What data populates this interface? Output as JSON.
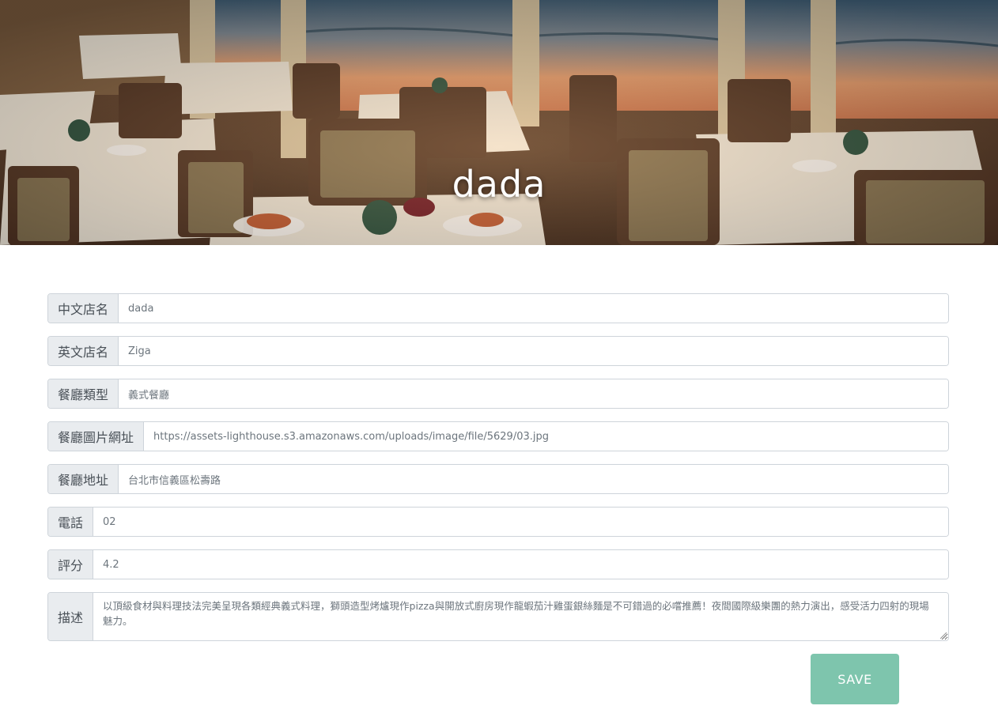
{
  "banner": {
    "title": "dada",
    "image": "restaurant-interior-photo"
  },
  "form": {
    "fields": [
      {
        "label": "中文店名",
        "value": "dada"
      },
      {
        "label": "英文店名",
        "value": "Ziga"
      },
      {
        "label": "餐廳類型",
        "value": "義式餐廳"
      },
      {
        "label": "餐廳圖片網址",
        "value": "https://assets-lighthouse.s3.amazonaws.com/uploads/image/file/5629/03.jpg"
      },
      {
        "label": "餐廳地址",
        "value": "台北市信義區松壽路"
      },
      {
        "label": "電話",
        "value": "02"
      },
      {
        "label": "評分",
        "value": "4.2"
      }
    ],
    "description": {
      "label": "描述",
      "value": "以頂級食材與料理技法完美呈現各類經典義式料理，獅頭造型烤爐現作pizza與開放式廚房現作龍蝦茄汁雞蛋銀絲麵是不可錯過的必嚐推薦！夜間國際級樂團的熱力演出，感受活力四射的現場魅力。"
    },
    "save_label": "SAVE"
  },
  "colors": {
    "button": "#7ec5ad",
    "addon_bg": "#e9ecef",
    "border": "#ced4da"
  }
}
